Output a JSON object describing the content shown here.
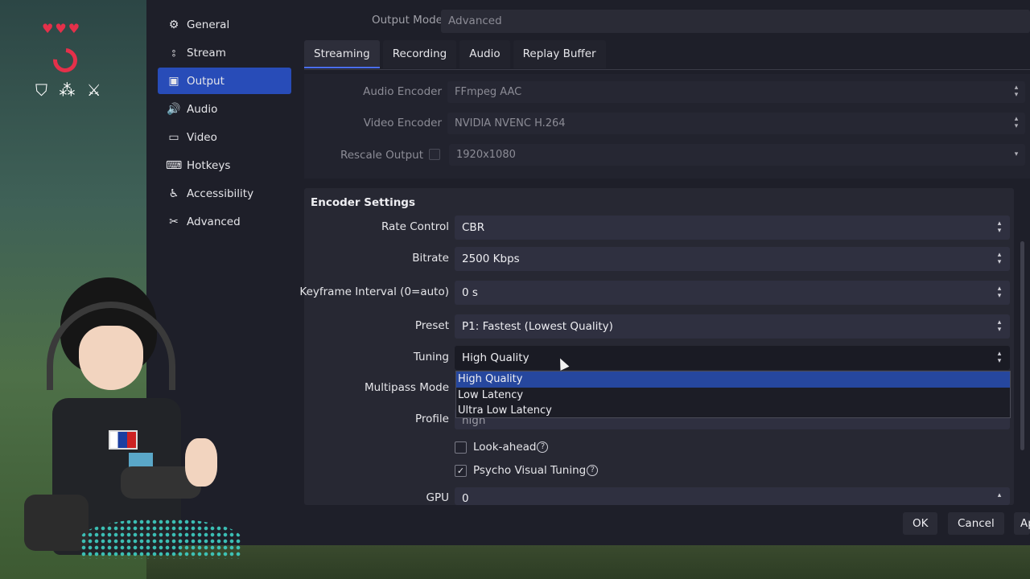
{
  "hud": {
    "hearts": "♥♥♥",
    "gear_icons": "⛉ ⁂ ⚔"
  },
  "sidebar": {
    "items": [
      {
        "label": "General",
        "icon": "gear-icon",
        "glyph": "⚙"
      },
      {
        "label": "Stream",
        "icon": "antenna-icon",
        "glyph": "⦂"
      },
      {
        "label": "Output",
        "icon": "output-icon",
        "glyph": "▣"
      },
      {
        "label": "Audio",
        "icon": "speaker-icon",
        "glyph": "🔊"
      },
      {
        "label": "Video",
        "icon": "monitor-icon",
        "glyph": "▭"
      },
      {
        "label": "Hotkeys",
        "icon": "keyboard-icon",
        "glyph": "⌨"
      },
      {
        "label": "Accessibility",
        "icon": "accessibility-icon",
        "glyph": "♿"
      },
      {
        "label": "Advanced",
        "icon": "tools-icon",
        "glyph": "✂"
      }
    ],
    "active": "Output"
  },
  "output_mode": {
    "label": "Output Mode",
    "value": "Advanced"
  },
  "tabs": [
    "Streaming",
    "Recording",
    "Audio",
    "Replay Buffer"
  ],
  "top_panel": {
    "audio_encoder": {
      "label": "Audio Encoder",
      "value": "FFmpeg AAC"
    },
    "video_encoder": {
      "label": "Video Encoder",
      "value": "NVIDIA NVENC H.264"
    },
    "rescale_output": {
      "label": "Rescale Output",
      "value": "1920x1080"
    }
  },
  "encoder": {
    "title": "Encoder Settings",
    "rate_control": {
      "label": "Rate Control",
      "value": "CBR"
    },
    "bitrate": {
      "label": "Bitrate",
      "value": "2500 Kbps"
    },
    "keyframe": {
      "label": "Keyframe Interval (0=auto)",
      "value": "0 s"
    },
    "preset": {
      "label": "Preset",
      "value": "P1: Fastest (Lowest Quality)"
    },
    "tuning": {
      "label": "Tuning",
      "value": "High Quality",
      "options": [
        "High Quality",
        "Low Latency",
        "Ultra Low Latency"
      ]
    },
    "multipass": {
      "label": "Multipass Mode"
    },
    "profile": {
      "label": "Profile",
      "value": "high"
    },
    "lookahead": {
      "label": "Look-ahead",
      "checked": false
    },
    "psycho": {
      "label": "Psycho Visual Tuning",
      "checked": true
    },
    "gpu": {
      "label": "GPU",
      "value": "0"
    }
  },
  "buttons": {
    "ok": "OK",
    "cancel": "Cancel",
    "apply": "Apply"
  },
  "colors": {
    "accent": "#284cb8",
    "dropdown_selected": "#26479e",
    "window_bg": "#1e1f29"
  }
}
